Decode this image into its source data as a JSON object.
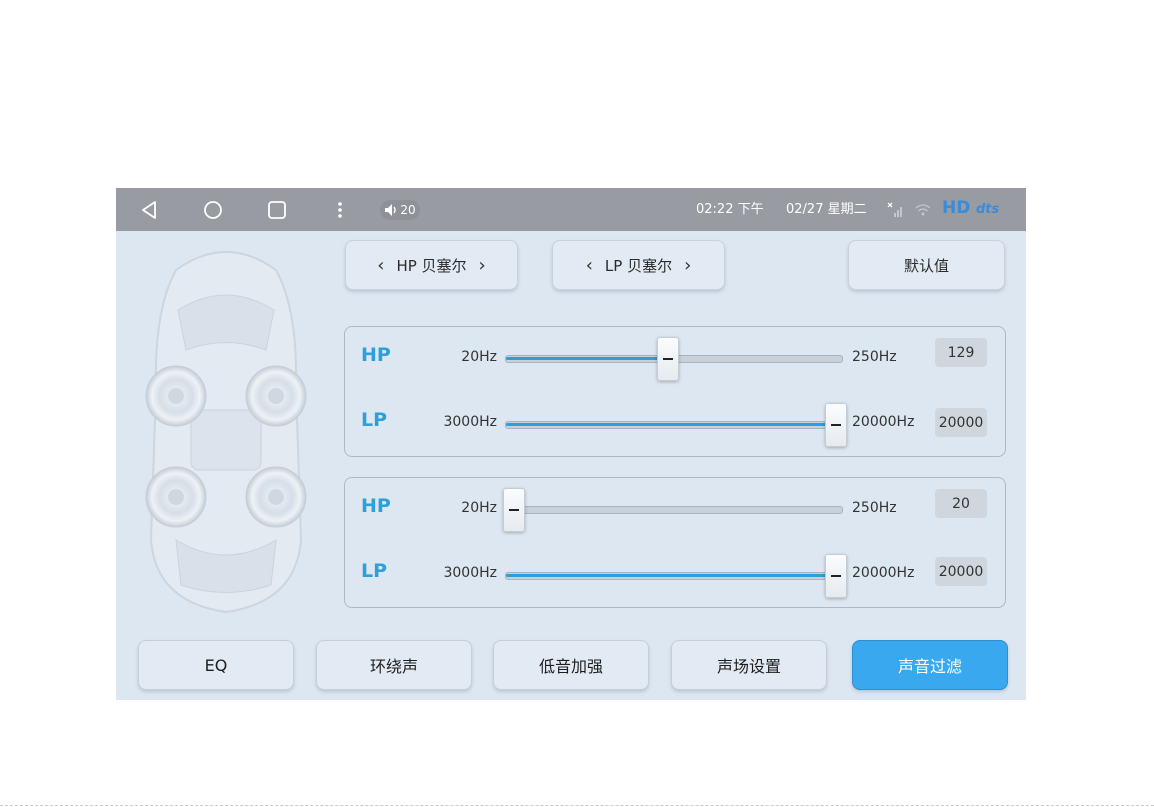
{
  "statusbar": {
    "volume": "20",
    "time": "02:22 下午",
    "date": "02/27 星期二",
    "hd": "HD",
    "brand": "dts"
  },
  "header_buttons": {
    "hp_preset": "HP 贝塞尔",
    "lp_preset": "LP 贝塞尔",
    "default": "默认值"
  },
  "panels": [
    {
      "hp": {
        "label": "HP",
        "min": "20Hz",
        "max": "250Hz",
        "value": "129",
        "level_pct": 48
      },
      "lp": {
        "label": "LP",
        "min": "3000Hz",
        "max": "20000Hz",
        "value": "20000",
        "level_pct": 98
      }
    },
    {
      "hp": {
        "label": "HP",
        "min": "20Hz",
        "max": "250Hz",
        "value": "20",
        "level_pct": 2
      },
      "lp": {
        "label": "LP",
        "min": "3000Hz",
        "max": "20000Hz",
        "value": "20000",
        "level_pct": 98
      }
    }
  ],
  "tabs": [
    "EQ",
    "环绕声",
    "低音加强",
    "声场设置",
    "声音过滤"
  ],
  "active_tab": 4,
  "colors": {
    "accent": "#2d9fd9",
    "active_tab": "#3aa8ee",
    "statusbar": "#989ba1",
    "background": "#dde7f1"
  }
}
